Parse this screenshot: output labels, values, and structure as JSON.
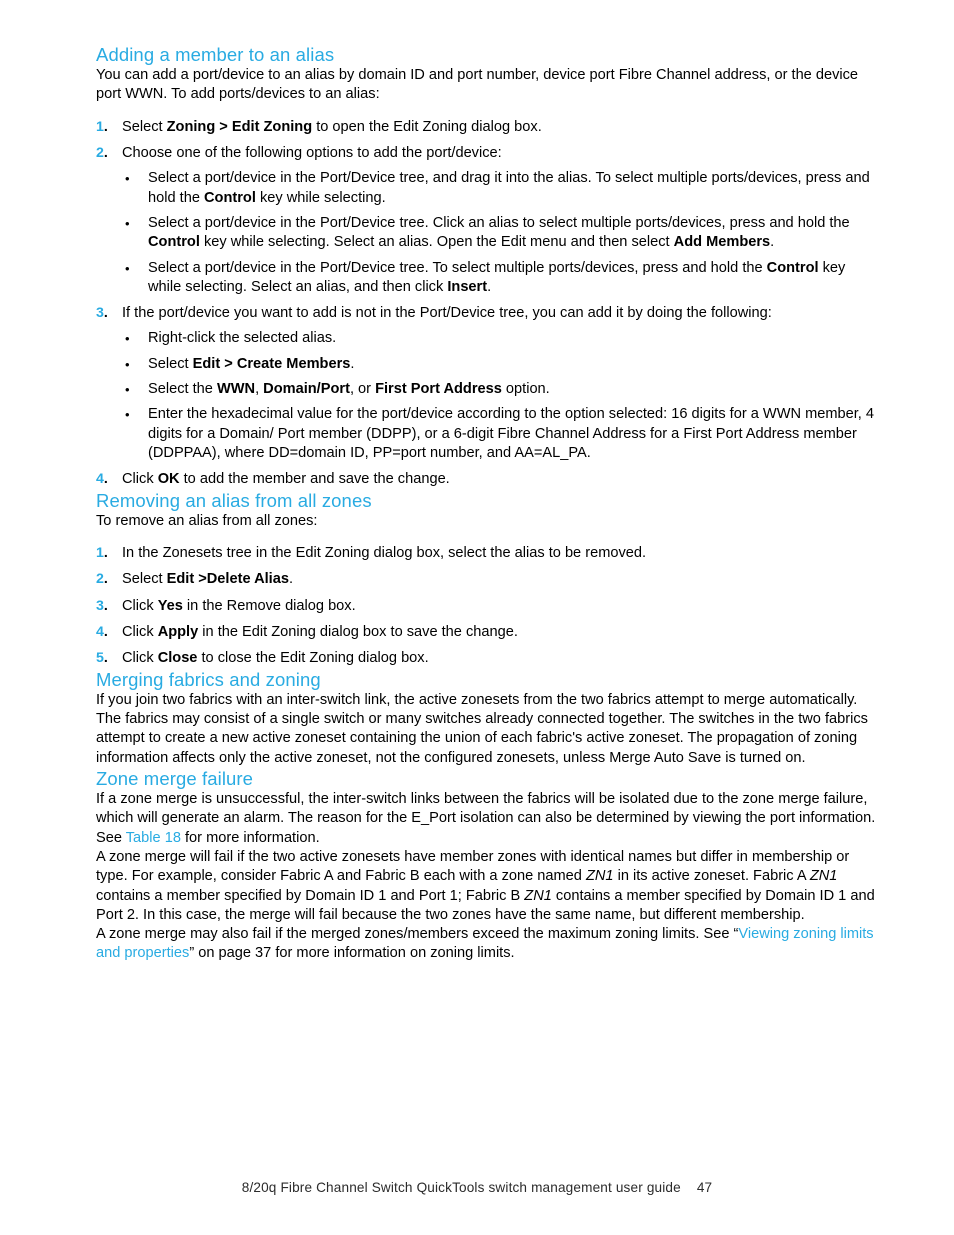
{
  "document": {
    "footer_title": "8/20q Fibre Channel Switch QuickTools switch management user guide",
    "page_number": "47"
  },
  "colors": {
    "heading_blue": "#29ABE2",
    "link_blue": "#29ABE2",
    "body_black": "#000000"
  },
  "sections": [
    {
      "heading": "Adding a member to an alias",
      "intro": "You can add a port/device to an alias by domain ID and port number, device port Fibre Channel address, or the device port WWN. To add ports/devices to an alias:",
      "steps": [
        {
          "number": "1.",
          "text_parts": [
            {
              "text": "Select ",
              "style": "normal"
            },
            {
              "text": "Zoning > Edit Zoning",
              "style": "bold"
            },
            {
              "text": " to open the Edit Zoning dialog box.",
              "style": "normal"
            }
          ]
        },
        {
          "number": "2.",
          "text_parts": [
            {
              "text": "Choose one of the following options to add the port/device:",
              "style": "normal"
            }
          ],
          "bullets": [
            [
              {
                "text": "Select a port/device in the Port/Device tree, and drag it into the alias. To select multiple ports/devices, press and hold the ",
                "style": "normal"
              },
              {
                "text": "Control",
                "style": "bold"
              },
              {
                "text": " key while selecting.",
                "style": "normal"
              }
            ],
            [
              {
                "text": "Select a port/device in the Port/Device tree. Click an alias to select multiple ports/devices, press and hold the ",
                "style": "normal"
              },
              {
                "text": "Control",
                "style": "bold"
              },
              {
                "text": " key while selecting. Select an alias. Open the Edit menu and then select ",
                "style": "normal"
              },
              {
                "text": "Add Members",
                "style": "bold"
              },
              {
                "text": ".",
                "style": "normal"
              }
            ],
            [
              {
                "text": "Select a port/device in the Port/Device tree. To select multiple ports/devices, press and hold the ",
                "style": "normal"
              },
              {
                "text": "Control",
                "style": "bold"
              },
              {
                "text": " key while selecting. Select an alias, and then click ",
                "style": "normal"
              },
              {
                "text": "Insert",
                "style": "bold"
              },
              {
                "text": ".",
                "style": "normal"
              }
            ]
          ]
        },
        {
          "number": "3.",
          "text_parts": [
            {
              "text": "If the port/device you want to add is not in the Port/Device tree, you can add it by doing the following:",
              "style": "normal"
            }
          ],
          "bullets": [
            [
              {
                "text": "Right-click the selected alias.",
                "style": "normal"
              }
            ],
            [
              {
                "text": "Select ",
                "style": "normal"
              },
              {
                "text": "Edit > Create Members",
                "style": "bold"
              },
              {
                "text": ".",
                "style": "normal"
              }
            ],
            [
              {
                "text": "Select the ",
                "style": "normal"
              },
              {
                "text": "WWN",
                "style": "bold"
              },
              {
                "text": ", ",
                "style": "normal"
              },
              {
                "text": "Domain/Port",
                "style": "bold"
              },
              {
                "text": ", or ",
                "style": "normal"
              },
              {
                "text": "First Port Address",
                "style": "bold"
              },
              {
                "text": " option.",
                "style": "normal"
              }
            ],
            [
              {
                "text": "Enter the hexadecimal value for the port/device according to the option selected: 16 digits for a WWN member, 4 digits for a Domain/ Port member (DDPP), or a 6-digit Fibre Channel Address for a First Port Address member (DDPPAA), where DD=domain ID, PP=port number, and AA=AL_PA.",
                "style": "normal"
              }
            ]
          ]
        },
        {
          "number": "4.",
          "text_parts": [
            {
              "text": "Click ",
              "style": "normal"
            },
            {
              "text": "OK",
              "style": "bold"
            },
            {
              "text": " to add the member and save the change.",
              "style": "normal"
            }
          ]
        }
      ]
    },
    {
      "heading": "Removing an alias from all zones",
      "intro": "To remove an alias from all zones:",
      "steps": [
        {
          "number": "1.",
          "text_parts": [
            {
              "text": "In the Zonesets tree in the Edit Zoning dialog box, select the alias to be removed.",
              "style": "normal"
            }
          ]
        },
        {
          "number": "2.",
          "text_parts": [
            {
              "text": "Select ",
              "style": "normal"
            },
            {
              "text": "Edit >Delete Alias",
              "style": "bold"
            },
            {
              "text": ".",
              "style": "normal"
            }
          ]
        },
        {
          "number": "3.",
          "text_parts": [
            {
              "text": "Click ",
              "style": "normal"
            },
            {
              "text": "Yes",
              "style": "bold"
            },
            {
              "text": " in the Remove dialog box.",
              "style": "normal"
            }
          ]
        },
        {
          "number": "4.",
          "text_parts": [
            {
              "text": "Click ",
              "style": "normal"
            },
            {
              "text": "Apply",
              "style": "bold"
            },
            {
              "text": " in the Edit Zoning dialog box to save the change.",
              "style": "normal"
            }
          ]
        },
        {
          "number": "5.",
          "text_parts": [
            {
              "text": "Click ",
              "style": "normal"
            },
            {
              "text": "Close",
              "style": "bold"
            },
            {
              "text": " to close the Edit Zoning dialog box.",
              "style": "normal"
            }
          ]
        }
      ]
    },
    {
      "heading": "Merging fabrics and zoning",
      "paragraphs": [
        [
          {
            "text": "If you join two fabrics with an inter-switch link, the active zonesets from the two fabrics attempt to merge automatically. The fabrics may consist of a single switch or many switches already connected together. The switches in the two fabrics attempt to create a new active zoneset containing the union of each fabric's active zoneset. The propagation of zoning information affects only the active zoneset, not the configured zonesets, unless Merge Auto Save is turned on.",
            "style": "normal"
          }
        ]
      ]
    },
    {
      "heading": "Zone merge failure",
      "paragraphs": [
        [
          {
            "text": "If a zone merge is unsuccessful, the inter-switch links between the fabrics will be isolated due to the zone merge failure, which will generate an alarm. The reason for the E_Port isolation can also be determined by viewing the port information. See ",
            "style": "normal"
          },
          {
            "text": "Table 18",
            "style": "link"
          },
          {
            "text": " for more information.",
            "style": "normal"
          }
        ],
        [
          {
            "text": "A zone merge will fail if the two active zonesets have member zones with identical names but differ in membership or type. For example, consider Fabric A and Fabric B each with a zone named ",
            "style": "normal"
          },
          {
            "text": "ZN1",
            "style": "italic"
          },
          {
            "text": " in its active zoneset. Fabric A ",
            "style": "normal"
          },
          {
            "text": "ZN1",
            "style": "italic"
          },
          {
            "text": " contains a member specified by Domain ID 1 and Port 1; Fabric B ",
            "style": "normal"
          },
          {
            "text": "ZN1",
            "style": "italic"
          },
          {
            "text": " contains a member specified by Domain ID 1 and Port 2. In this case, the merge will fail because the two zones have the same name, but different membership.",
            "style": "normal"
          }
        ],
        [
          {
            "text": "A zone merge may also fail if the merged zones/members exceed the maximum zoning limits. See “",
            "style": "normal"
          },
          {
            "text": "Viewing zoning limits and properties",
            "style": "link"
          },
          {
            "text": "” on page 37 for more information on zoning limits.",
            "style": "normal"
          }
        ]
      ]
    }
  ]
}
